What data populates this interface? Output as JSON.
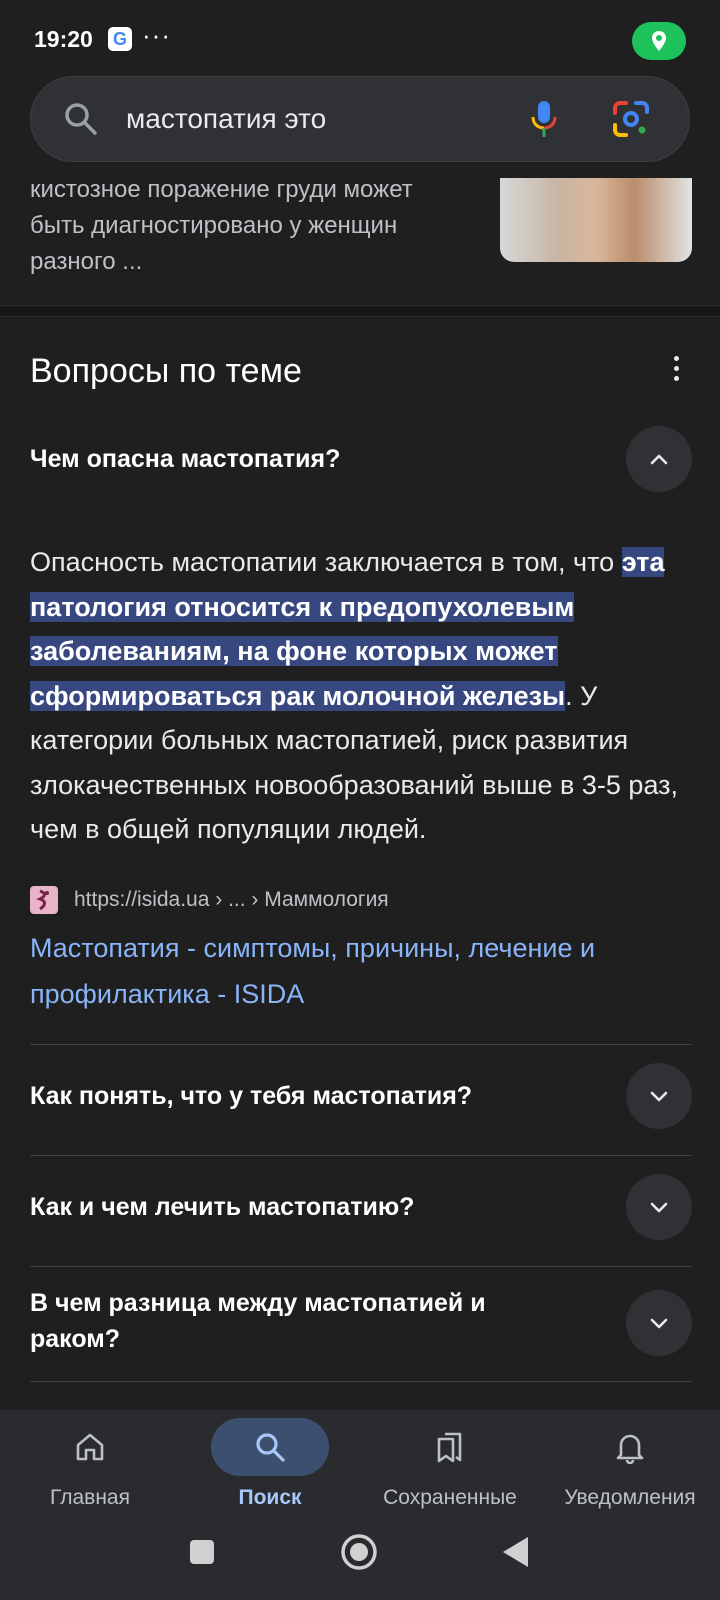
{
  "status_bar": {
    "time": "19:20",
    "google_badge": "G",
    "more": "···"
  },
  "search": {
    "query": "мастопатия это"
  },
  "previous_result": {
    "snippet": "кистозное поражение груди может быть диагностировано у женщин разного ..."
  },
  "related_questions": {
    "title": "Вопросы по теме",
    "expanded": {
      "question": "Чем опасна мастопатия?",
      "answer_before": "Опасность мастопатии заключается в том, что ",
      "answer_highlight": "эта патология относится к предопухолевым заболеваниям, на фоне которых может сформироваться рак молочной железы",
      "answer_after": ". У категории больных мастопатией, риск развития злокачественных новообразований выше в 3-5 раз, чем в общей популяции людей.",
      "source_url": "https://isida.ua › ... › Маммология",
      "link_title": "Мастопатия - симптомы, причины, лечение и профилактика - ISIDA"
    },
    "questions": [
      "Как понять, что у тебя мастопатия?",
      "Как и чем лечить мастопатию?",
      "В чем разница между мастопатией и раком?"
    ]
  },
  "bottom_nav": {
    "items": [
      {
        "label": "Главная",
        "icon": "home-icon"
      },
      {
        "label": "Поиск",
        "icon": "search-icon",
        "active": true
      },
      {
        "label": "Сохраненные",
        "icon": "bookmarks-icon"
      },
      {
        "label": "Уведомления",
        "icon": "bell-icon"
      }
    ]
  },
  "colors": {
    "background": "#1f1f1f",
    "link": "#8ab4f8",
    "highlight": "#37477f",
    "active_nav": "#a8c7fa"
  }
}
